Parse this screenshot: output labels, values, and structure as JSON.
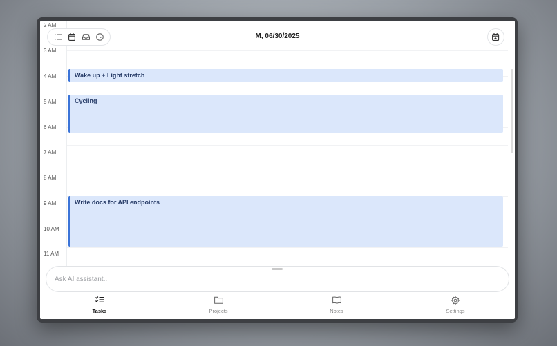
{
  "header": {
    "date": "M, 06/30/2025"
  },
  "toolbar": {
    "icons": [
      "list-icon",
      "calendar-icon",
      "inbox-icon",
      "clock-icon"
    ]
  },
  "timeline": {
    "hours": [
      "2 AM",
      "3 AM",
      "4 AM",
      "5 AM",
      "6 AM",
      "7 AM",
      "8 AM",
      "9 AM",
      "10 AM",
      "11 AM"
    ],
    "events": [
      {
        "title": "Wake up + Light stretch",
        "start": "4:00 AM",
        "end": "4:30 AM"
      },
      {
        "title": "Cycling",
        "start": "5:00 AM",
        "end": "6:30 AM"
      },
      {
        "title": "Write docs for API endpoints",
        "start": "9:00 AM",
        "end": "11:00 AM"
      }
    ]
  },
  "assistant": {
    "placeholder": "Ask AI assistant..."
  },
  "nav": {
    "items": [
      {
        "label": "Tasks",
        "icon": "tasks-icon",
        "active": true
      },
      {
        "label": "Projects",
        "icon": "folder-icon",
        "active": false
      },
      {
        "label": "Notes",
        "icon": "book-icon",
        "active": false
      },
      {
        "label": "Settings",
        "icon": "gear-icon",
        "active": false
      }
    ]
  },
  "colors": {
    "event_bg": "#dbe7fb",
    "event_accent": "#3b74d8"
  }
}
